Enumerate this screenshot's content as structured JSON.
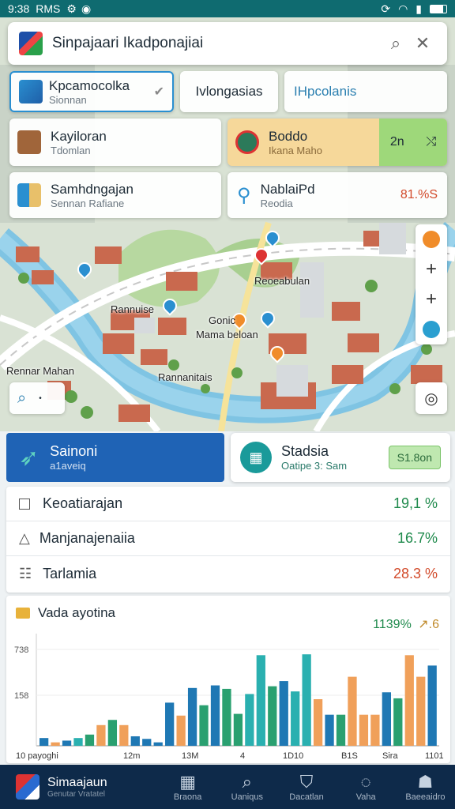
{
  "status_bar": {
    "time": "9:38",
    "left_text": "RMS",
    "icons": [
      "settings-icon",
      "whatsapp-icon",
      "sync-icon",
      "wifi-icon",
      "signal-icon",
      "battery-icon"
    ]
  },
  "search": {
    "title": "Sinpajaari Ikadponajiai",
    "search_icon": "search-icon",
    "close_icon": "close-icon"
  },
  "filter_cards": [
    {
      "title": "Kpcamocolka",
      "subtitle": "Sionnan",
      "selected": true
    },
    {
      "title": "Ivlongasias",
      "subtitle": ""
    },
    {
      "title": "IHpcolanis",
      "subtitle": ""
    }
  ],
  "info_cards": [
    {
      "title": "Kayiloran",
      "subtitle": "Tdomlan"
    },
    {
      "title": "Boddo",
      "subtitle": "Ikana Maho",
      "badge": "2n"
    },
    {
      "title": "Samhdngajan",
      "subtitle": "Sennan Rafiane"
    },
    {
      "title": "NablaiPd",
      "subtitle": "Reodia",
      "value": "81.%S"
    }
  ],
  "map_labels": {
    "l1": "Reoeabulan",
    "l2": "Rannuise",
    "l3": "Gonic",
    "l4": "Mama beloan",
    "l5": "Rannanitais",
    "l6": "Rennar Mahan"
  },
  "panels": {
    "left": {
      "title": "Sainoni",
      "subtitle": "a1aveiq"
    },
    "right": {
      "title": "Stadsia",
      "subtitle": "Oatipe 3: Sam",
      "badge": "S1.8on"
    }
  },
  "stats": [
    {
      "label": "Keoatiarajan",
      "value": "19,1 %",
      "color": "#1f8a4c",
      "icon": "square-icon"
    },
    {
      "label": "Manjanajenaiia",
      "value": "16.7%",
      "color": "#1f8a4c",
      "icon": "triangle-icon"
    },
    {
      "label": "Tarlamia",
      "value": "28.3 %",
      "color": "#d24a2a",
      "icon": "calendar-icon"
    }
  ],
  "chart_header": {
    "title": "Vada ayotina",
    "value": "1139%",
    "secondary": "↗.6"
  },
  "chart_data": {
    "type": "bar",
    "title": "Vada ayotina",
    "y_ticks": [
      "738",
      "158"
    ],
    "x_ticks": [
      "10 payoghi",
      "12m",
      "13M",
      "4",
      "1D10",
      "B1S",
      "Sira",
      "1101"
    ],
    "values": [
      9,
      4,
      6,
      9,
      13,
      24,
      30,
      24,
      11,
      8,
      4,
      50,
      35,
      67,
      47,
      70,
      66,
      37,
      60,
      105,
      69,
      75,
      63,
      106,
      54,
      36,
      36,
      80,
      36,
      36,
      62,
      55,
      105,
      80,
      93
    ],
    "colors": [
      "#1f78b4",
      "#f0a05a",
      "#1f78b4",
      "#2ab0b0",
      "#2aa070",
      "#f0a05a",
      "#2aa070",
      "#f0a05a",
      "#1f78b4",
      "#1f78b4",
      "#1f78b4",
      "#1f78b4",
      "#f0a05a",
      "#1f78b4",
      "#2aa070",
      "#1f78b4",
      "#2aa070",
      "#2aa070",
      "#2ab0b0",
      "#2ab0b0",
      "#2aa070",
      "#1f78b4",
      "#2ab0b0",
      "#2ab0b0",
      "#f0a05a",
      "#1f78b4",
      "#2aa070",
      "#f0a05a",
      "#f0a05a",
      "#f0a05a",
      "#1f78b4",
      "#2aa070",
      "#f0a05a",
      "#f0a05a",
      "#1f78b4"
    ],
    "ylim": [
      0,
      130
    ]
  },
  "bottom_nav": {
    "brand": "Simaajaun",
    "brand_sub": "Genutar Vratatel",
    "items": [
      {
        "label": "Braona",
        "icon": "grid-icon"
      },
      {
        "label": "Uaniqus",
        "icon": "search-icon"
      },
      {
        "label": "Dacatlan",
        "icon": "shield-check-icon"
      },
      {
        "label": "Vaha",
        "icon": "chat-icon"
      },
      {
        "label": "Baeeaidro",
        "icon": "person-icon"
      }
    ]
  }
}
